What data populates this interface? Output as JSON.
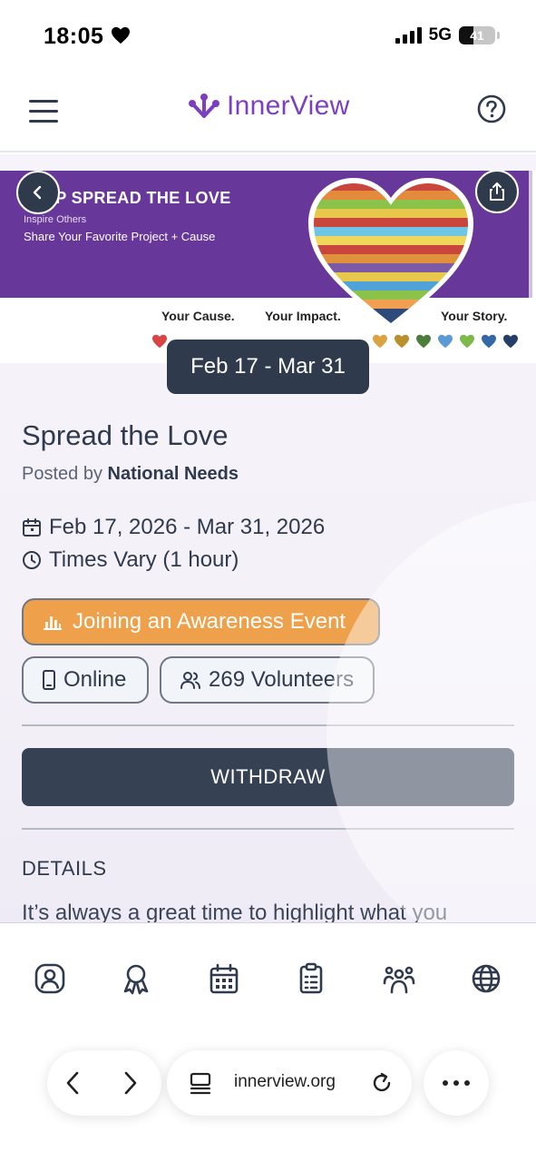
{
  "status_bar": {
    "time": "18:05",
    "network": "5G",
    "battery": "41",
    "battery_level": 0.41
  },
  "header": {
    "brand": "InnerView",
    "menu_icon": "hamburger-menu-icon",
    "help_icon": "help-circle-icon"
  },
  "banner": {
    "title": "HELP SPREAD THE LOVE",
    "subtitle": "Inspire Others",
    "tagline": "Share Your Favorite Project + Cause",
    "tag_cause": "Your Cause.",
    "tag_impact": "Your Impact.",
    "tag_story": "Your Story."
  },
  "event": {
    "date_chip": "Feb 17 - Mar 31",
    "title": "Spread the Love",
    "posted_prefix": "Posted by",
    "organizer": "National Needs",
    "date_range": "Feb 17, 2026 - Mar 31, 2026",
    "time": "Times Vary (1 hour)",
    "category": "Joining an Awareness Event",
    "location": "Online",
    "volunteers": "269 Volunteers"
  },
  "actions": {
    "withdraw": "WITHDRAW"
  },
  "details": {
    "heading": "DETAILS",
    "text": "It’s always a great time to highlight what you"
  },
  "tabs": [
    "profile-icon",
    "award-icon",
    "calendar-icon",
    "clipboard-icon",
    "community-icon",
    "globe-icon"
  ],
  "browser": {
    "url": "innerview.org"
  },
  "colors": {
    "brand_purple": "#7b3fbf",
    "banner_purple": "#68379a",
    "dark": "#364154",
    "category_orange": "#efa04a"
  }
}
